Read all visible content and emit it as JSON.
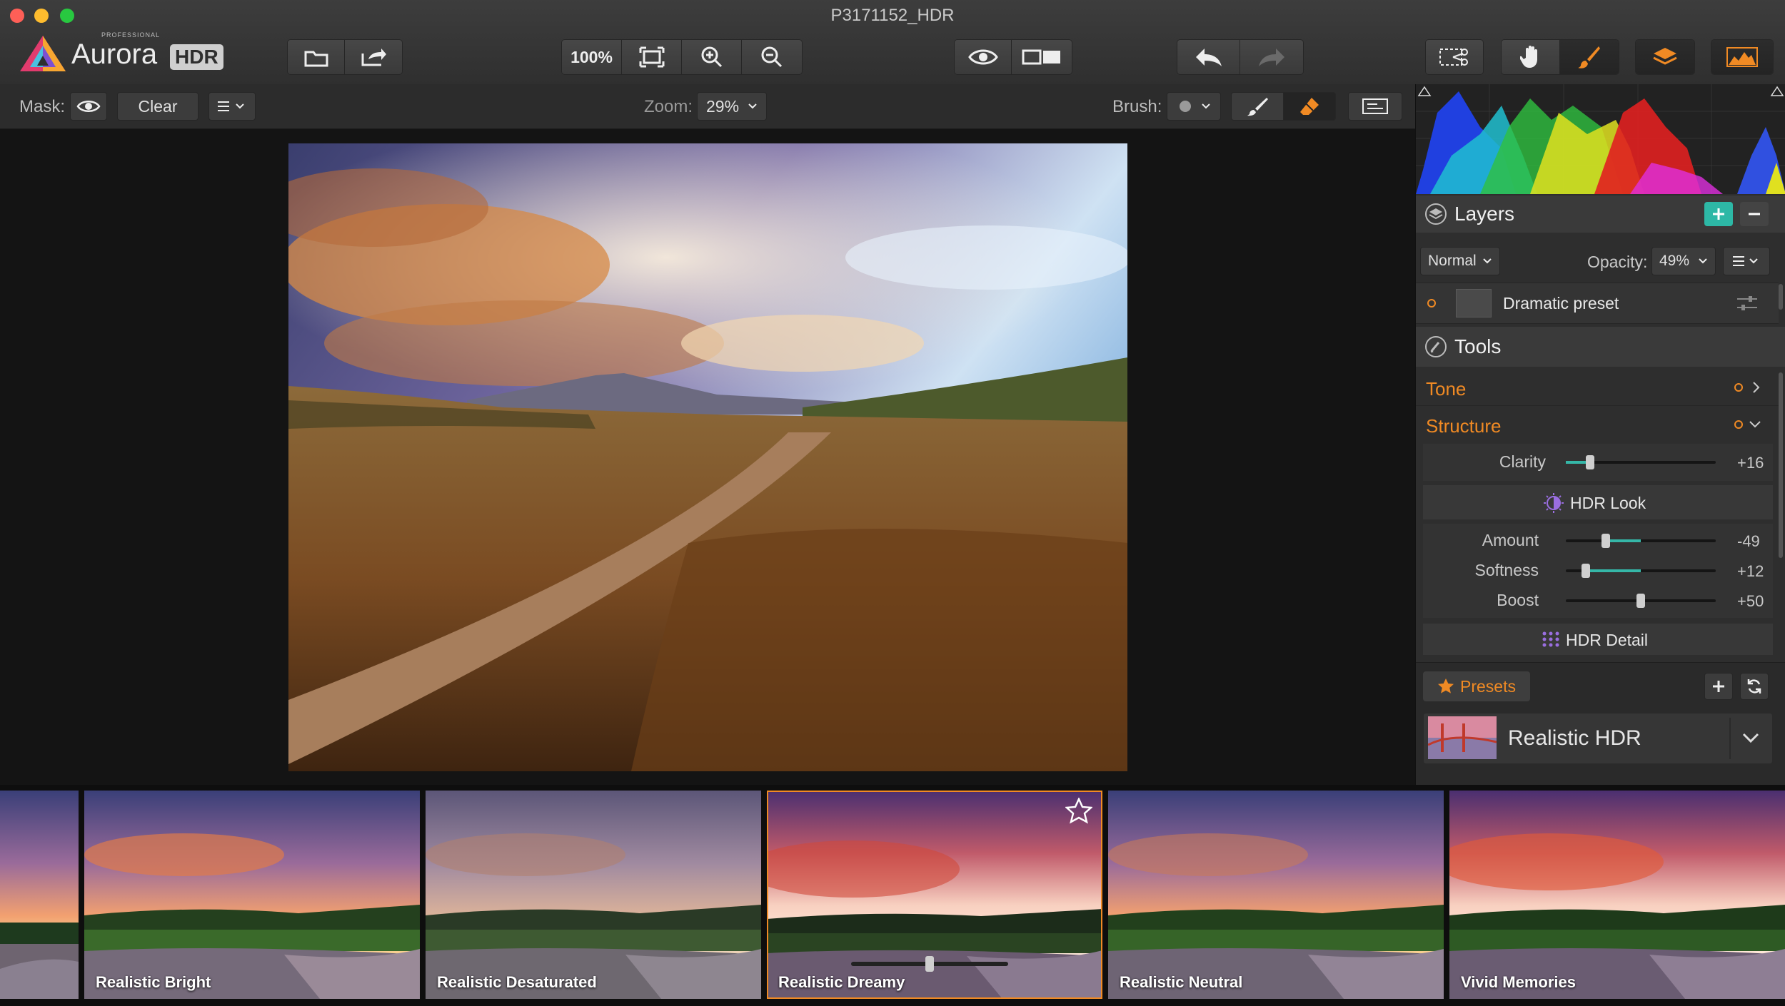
{
  "window": {
    "title": "P3171152_HDR"
  },
  "logo": {
    "small": "PROFESSIONAL",
    "name": "Aurora",
    "badge": "HDR"
  },
  "toolbar": {
    "zoom_100": "100%"
  },
  "maskbar": {
    "mask_label": "Mask:",
    "clear_label": "Clear",
    "zoom_label": "Zoom:",
    "zoom_value": "29%",
    "brush_label": "Brush:"
  },
  "layers": {
    "title": "Layers",
    "blend_mode": "Normal",
    "opacity_label": "Opacity:",
    "opacity_value": "49%",
    "items": [
      {
        "name": "Dramatic preset"
      }
    ]
  },
  "tools": {
    "title": "Tools",
    "tone": "Tone",
    "structure": "Structure",
    "clarity": {
      "label": "Clarity",
      "value": "+16",
      "level": 0.16
    },
    "hdr_look": {
      "title": "HDR Look"
    },
    "amount": {
      "label": "Amount",
      "value": "-49",
      "level": 0.26
    },
    "softness": {
      "label": "Softness",
      "value": "+12",
      "level": 0.12
    },
    "boost": {
      "label": "Boost",
      "value": "+50",
      "level": 0.5
    },
    "hdr_detail": {
      "title": "HDR Detail"
    }
  },
  "presets": {
    "tab_label": "Presets",
    "current": "Realistic HDR"
  },
  "filmstrip": {
    "items": [
      {
        "label": ""
      },
      {
        "label": "Realistic Bright"
      },
      {
        "label": "Realistic Desaturated"
      },
      {
        "label": "Realistic Dreamy"
      },
      {
        "label": "Realistic Neutral"
      },
      {
        "label": "Vivid Memories"
      }
    ]
  },
  "colors": {
    "accent": "#f08a24",
    "teal": "#35b7a8",
    "panel": "#2e2e2e"
  }
}
